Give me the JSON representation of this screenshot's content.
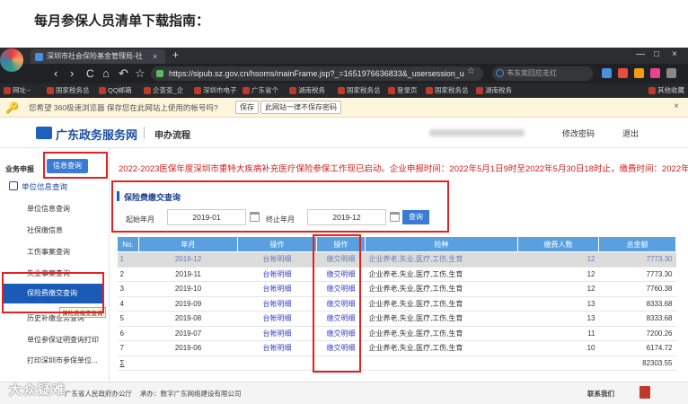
{
  "heading": "每月参保人员清单下载指南：",
  "browser": {
    "tab_title": "深圳市社会保险基金管理局-社",
    "tab_close": "×",
    "tab_plus": "+",
    "url": "https://sipub.sz.gov.cn/hsoms/mainFrame.jsp?_=1651976636833&_usersession_u",
    "search_placeholder": "韦东奕回应走红",
    "nav": {
      "back": "‹",
      "forward": "›",
      "reload": "C",
      "home": "⌂",
      "undo": "↶",
      "star": "☆"
    },
    "window_controls": [
      "—",
      "□",
      "×"
    ],
    "bookmarks": [
      "网址--",
      "国家税务总",
      "QQ邮箱",
      "企查查_企",
      "深圳市电子",
      "广东省个",
      "湖南税务",
      "国家税务总",
      "登录页",
      "国家税务总",
      "湖南税务"
    ],
    "bookmarks_folder": "其他收藏"
  },
  "password_bar": {
    "text": "您希望 360极速浏览器 保存您在此网站上使用的帐号吗?",
    "save": "保存",
    "never": "此网站一律不保存密码",
    "close": "×"
  },
  "site": {
    "name": "广东政务服务网",
    "subtitle": "申办流程",
    "change_password": "修改密码",
    "logout": "退出"
  },
  "sidebar": {
    "service_label": "业务申报",
    "query_button": "信息查询",
    "section_title": "单位信息查询",
    "items": [
      "单位信息查询",
      "社保缴信息",
      "工伤事案查询",
      "失业事案查询",
      "保险费缴交查询",
      "历史补缴业务查询",
      "单位参保证明查询打印",
      "打印深圳市参保单位..."
    ],
    "tooltip": "保险费缴交查询"
  },
  "notice": "2022-2023医保年度深圳市重特大疾病补充医疗保险参保工作现已启动。企业申报时间：2022年5月1日9时至2022年5月30日18时止，缴费时间：2022年5",
  "query": {
    "title": "保险费缴交查询",
    "start_label": "起始年月",
    "start_value": "2019-01",
    "end_label": "终止年月",
    "end_value": "2019-12",
    "search_button": "查询"
  },
  "table": {
    "headers": [
      "No.",
      "年月",
      "操作",
      "操作",
      "险种",
      "缴费人数",
      "总金额"
    ],
    "rows": [
      {
        "no": "1",
        "month": "2019-12",
        "op1": "台帐明细",
        "op2": "缴交明细",
        "types": "企业养老,失业,医疗,工伤,生育",
        "count": "12",
        "amount": "7773.30"
      },
      {
        "no": "2",
        "month": "2019-11",
        "op1": "台帐明细",
        "op2": "缴交明细",
        "types": "企业养老,失业,医疗,工伤,生育",
        "count": "12",
        "amount": "7773.30"
      },
      {
        "no": "3",
        "month": "2019-10",
        "op1": "台帐明细",
        "op2": "缴交明细",
        "types": "企业养老,失业,医疗,工伤,生育",
        "count": "12",
        "amount": "7760.38"
      },
      {
        "no": "4",
        "month": "2019-09",
        "op1": "台帐明细",
        "op2": "缴交明细",
        "types": "企业养老,失业,医疗,工伤,生育",
        "count": "13",
        "amount": "8333.68"
      },
      {
        "no": "5",
        "month": "2019-08",
        "op1": "台帐明细",
        "op2": "缴交明细",
        "types": "企业养老,失业,医疗,工伤,生育",
        "count": "13",
        "amount": "8333.68"
      },
      {
        "no": "6",
        "month": "2019-07",
        "op1": "台帐明细",
        "op2": "缴交明细",
        "types": "企业养老,失业,医疗,工伤,生育",
        "count": "11",
        "amount": "7200.26"
      },
      {
        "no": "7",
        "month": "2019-06",
        "op1": "台帐明细",
        "op2": "缴交明细",
        "types": "企业养老,失业,医疗,工伤,生育",
        "count": "10",
        "amount": "6174.72"
      }
    ],
    "total_label": "Σ",
    "total_amount": "82303.55"
  },
  "footer": {
    "org": "广东省人民政府办公厅",
    "tech": "承办：数字广东网络建设有限公司",
    "contact": "联系我们"
  },
  "watermark": "大众疑难"
}
